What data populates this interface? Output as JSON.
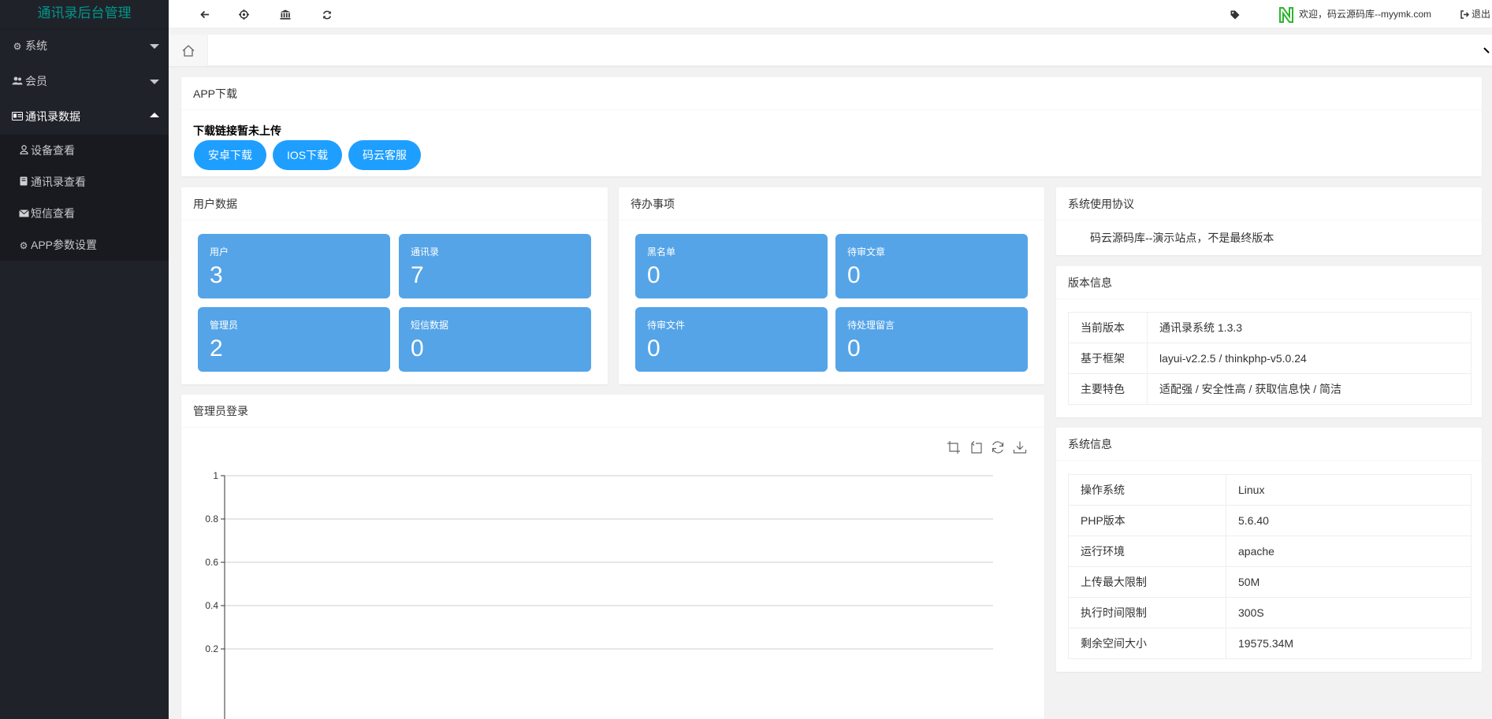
{
  "sidebar": {
    "title": "通讯录后台管理",
    "menus": [
      {
        "label": "系统",
        "icon": "gear-icon"
      },
      {
        "label": "会员",
        "icon": "users-icon"
      },
      {
        "label": "通讯录数据",
        "icon": "id-card-icon"
      }
    ],
    "submenu": [
      {
        "label": "设备查看",
        "icon": "user-icon"
      },
      {
        "label": "通讯录查看",
        "icon": "book-icon"
      },
      {
        "label": "短信查看",
        "icon": "envelope-icon"
      },
      {
        "label": "APP参数设置",
        "icon": "gear-icon"
      }
    ]
  },
  "header": {
    "welcome": "欢迎，码云源码库--myymk.com",
    "logout": "退出"
  },
  "app_download": {
    "title": "APP下载",
    "notice": "下载链接暂未上传",
    "buttons": [
      "安卓下载",
      "IOS下载",
      "码云客服"
    ]
  },
  "user_data": {
    "title": "用户数据",
    "stats": [
      {
        "label": "用户",
        "value": "3"
      },
      {
        "label": "通讯录",
        "value": "7"
      },
      {
        "label": "管理员",
        "value": "2"
      },
      {
        "label": "短信数据",
        "value": "0"
      }
    ]
  },
  "todo": {
    "title": "待办事项",
    "stats": [
      {
        "label": "黑名单",
        "value": "0"
      },
      {
        "label": "待审文章",
        "value": "0"
      },
      {
        "label": "待审文件",
        "value": "0"
      },
      {
        "label": "待处理留言",
        "value": "0"
      }
    ]
  },
  "agreement": {
    "title": "系统使用协议",
    "text": "码云源码库--演示站点，不是最终版本"
  },
  "version": {
    "title": "版本信息",
    "rows": [
      {
        "key": "当前版本",
        "value": "通讯录系统 1.3.3"
      },
      {
        "key": "基于框架",
        "value": "layui-v2.2.5 / thinkphp-v5.0.24"
      },
      {
        "key": "主要特色",
        "value": "适配强 / 安全性高 / 获取信息快 / 简洁"
      }
    ]
  },
  "system": {
    "title": "系统信息",
    "rows": [
      {
        "key": "操作系统",
        "value": "Linux"
      },
      {
        "key": "PHP版本",
        "value": "5.6.40"
      },
      {
        "key": "运行环境",
        "value": "apache"
      },
      {
        "key": "上传最大限制",
        "value": "50M"
      },
      {
        "key": "执行时间限制",
        "value": "300S"
      },
      {
        "key": "剩余空间大小",
        "value": "19575.34M"
      }
    ]
  },
  "admin_login": {
    "title": "管理员登录"
  },
  "chart_data": {
    "type": "line",
    "title": "",
    "xlabel": "",
    "ylabel": "",
    "ylim": [
      0,
      1
    ],
    "yticks": [
      "1",
      "0.8",
      "0.6",
      "0.4",
      "0.2"
    ],
    "series": [],
    "grid": true,
    "colors": {
      "grid": "#cccccc",
      "axis": "#333333"
    }
  },
  "colors": {
    "sidebar_bg": "#20222a",
    "brand": "#009688",
    "button": "#1e9fff",
    "stat_bg": "#55a4e8"
  }
}
